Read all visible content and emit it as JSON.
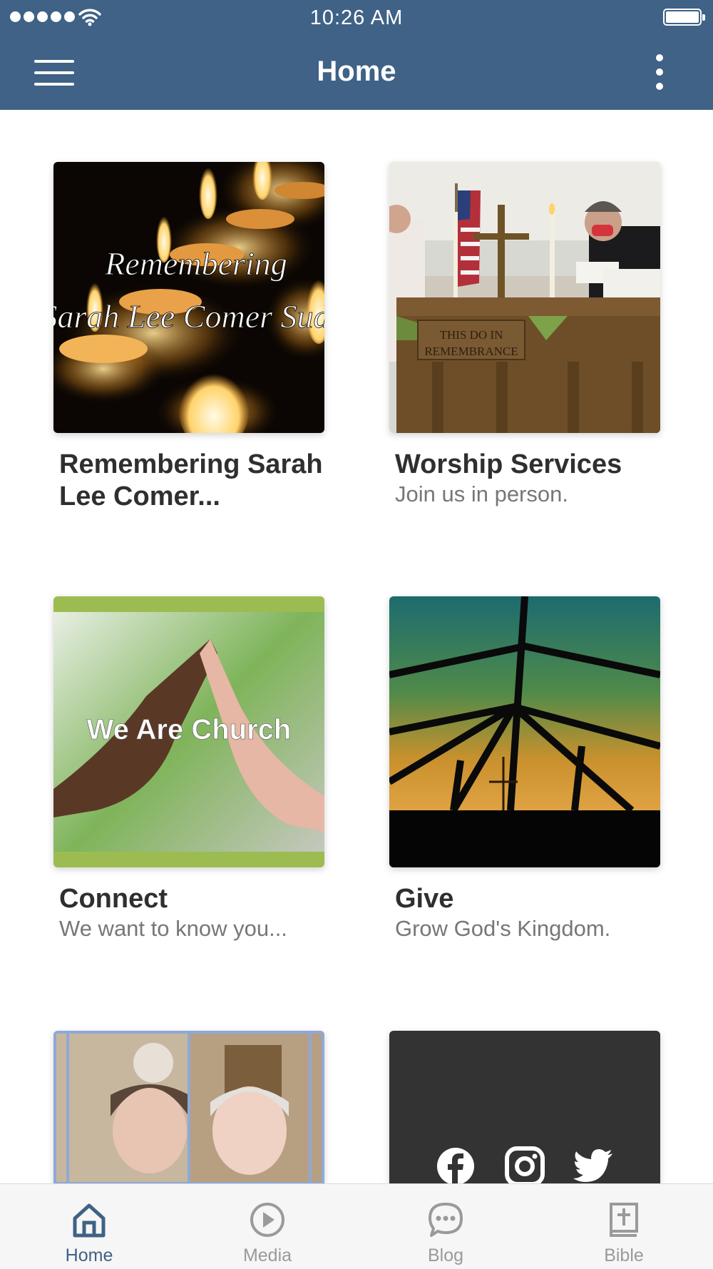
{
  "status_bar": {
    "time": "10:26 AM"
  },
  "header": {
    "title": "Home"
  },
  "tiles": [
    {
      "title": "Remembering Sarah Lee Comer...",
      "subtitle": "",
      "image_text_line1": "Remembering",
      "image_text_line2": "Sarah Lee Comer Sud"
    },
    {
      "title": "Worship Services",
      "subtitle": "Join us in person.",
      "image_text_line1": "THIS DO IN",
      "image_text_line2": "REMEMBRANCE"
    },
    {
      "title": "Connect",
      "subtitle": "We want to know you...",
      "image_text": "We Are Church"
    },
    {
      "title": "Give",
      "subtitle": "Grow God's Kingdom."
    }
  ],
  "social_icons": [
    "facebook-icon",
    "instagram-icon",
    "twitter-icon"
  ],
  "tabs": [
    {
      "label": "Home",
      "icon": "home-icon",
      "active": true
    },
    {
      "label": "Media",
      "icon": "play-icon",
      "active": false
    },
    {
      "label": "Blog",
      "icon": "chat-icon",
      "active": false
    },
    {
      "label": "Bible",
      "icon": "bible-icon",
      "active": false
    }
  ],
  "colors": {
    "primary": "#3f6286",
    "tab_inactive": "#9a9a9a"
  }
}
